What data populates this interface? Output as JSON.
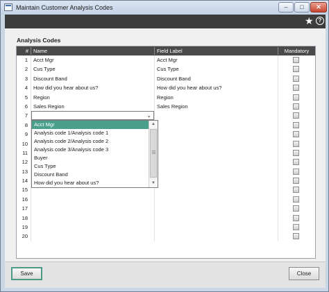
{
  "window": {
    "title": "Maintain Customer Analysis Codes",
    "controls": {
      "minimize": "–",
      "maximize": "□",
      "close": "✕"
    }
  },
  "header": {
    "icons": [
      "star-icon",
      "help-icon"
    ],
    "help_glyph": "?"
  },
  "section_title": "Analysis Codes",
  "table": {
    "columns": {
      "num": "#",
      "name": "Name",
      "label": "Field Label",
      "mandatory": "Mandatory"
    },
    "rows": [
      {
        "num": "1",
        "name": "Acct Mgr",
        "label": "Acct Mgr"
      },
      {
        "num": "2",
        "name": "Cus Type",
        "label": "Cus Type"
      },
      {
        "num": "3",
        "name": "Discount Band",
        "label": "Discount Band"
      },
      {
        "num": "4",
        "name": "How did you hear about us?",
        "label": "How did you hear about us?"
      },
      {
        "num": "5",
        "name": "Region",
        "label": "Region"
      },
      {
        "num": "6",
        "name": "Sales Region",
        "label": "Sales Region"
      },
      {
        "num": "7",
        "name": "",
        "label": ""
      },
      {
        "num": "8",
        "name": "",
        "label": ""
      },
      {
        "num": "9",
        "name": "",
        "label": ""
      },
      {
        "num": "10",
        "name": "",
        "label": ""
      },
      {
        "num": "11",
        "name": "",
        "label": ""
      },
      {
        "num": "12",
        "name": "",
        "label": ""
      },
      {
        "num": "13",
        "name": "",
        "label": ""
      },
      {
        "num": "14",
        "name": "",
        "label": ""
      },
      {
        "num": "15",
        "name": "",
        "label": ""
      },
      {
        "num": "16",
        "name": "",
        "label": ""
      },
      {
        "num": "17",
        "name": "",
        "label": ""
      },
      {
        "num": "18",
        "name": "",
        "label": ""
      },
      {
        "num": "19",
        "name": "",
        "label": ""
      },
      {
        "num": "20",
        "name": "",
        "label": ""
      }
    ]
  },
  "dropdown": {
    "current_value": "",
    "selected_index": 0,
    "options": [
      "Acct Mgr",
      "Analysis code 1/Analysis code 1",
      "Analysis code 2/Analysis code 2",
      "Analysis code 3/Analysis code 3",
      "Buyer",
      "Cus Type",
      "Discount Band",
      "How did you hear about us?"
    ]
  },
  "footer": {
    "save_label": "Save",
    "close_label": "Close"
  },
  "colors": {
    "accent": "#4ba08c",
    "header": "#3c3c3c",
    "frame": "#c9d6e6"
  }
}
